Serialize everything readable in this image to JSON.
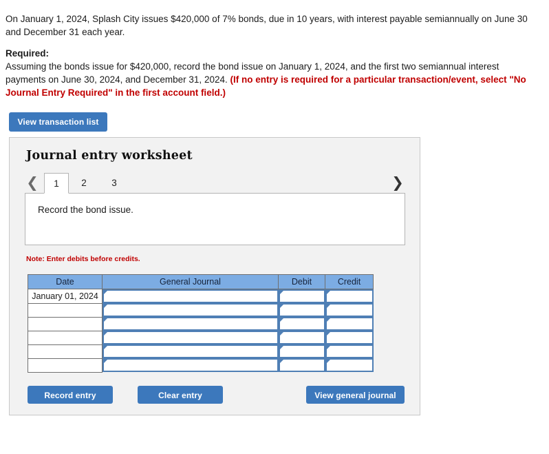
{
  "problem": {
    "statement": "On January 1, 2024, Splash City issues $420,000 of 7% bonds, due in 10 years, with interest payable semiannually on June 30 and December 31 each year."
  },
  "required": {
    "label": "Required:",
    "body_normal": "Assuming the bonds issue for $420,000, record the bond issue on January 1, 2024, and the first two semiannual interest payments on June 30, 2024, and December 31, 2024. ",
    "body_red": "(If no entry is required for a particular transaction/event, select \"No Journal Entry Required\" in the first account field.)"
  },
  "toolbar": {
    "view_transaction_list_label": "View transaction list"
  },
  "worksheet": {
    "title": "Journal entry worksheet",
    "prev_icon": "chevron-left-icon",
    "next_icon": "chevron-right-icon",
    "tabs": [
      {
        "label": "1",
        "active": true
      },
      {
        "label": "2",
        "active": false
      },
      {
        "label": "3",
        "active": false
      }
    ],
    "instruction": "Record the bond issue.",
    "note": "Note: Enter debits before credits.",
    "table": {
      "headers": [
        "Date",
        "General Journal",
        "Debit",
        "Credit"
      ],
      "rows": [
        {
          "date": "January 01, 2024",
          "general_journal": "",
          "debit": "",
          "credit": ""
        },
        {
          "date": "",
          "general_journal": "",
          "debit": "",
          "credit": ""
        },
        {
          "date": "",
          "general_journal": "",
          "debit": "",
          "credit": ""
        },
        {
          "date": "",
          "general_journal": "",
          "debit": "",
          "credit": ""
        },
        {
          "date": "",
          "general_journal": "",
          "debit": "",
          "credit": ""
        },
        {
          "date": "",
          "general_journal": "",
          "debit": "",
          "credit": ""
        }
      ]
    },
    "buttons": {
      "record_entry": "Record entry",
      "clear_entry": "Clear entry",
      "view_general_journal": "View general journal"
    }
  },
  "colors": {
    "button_blue": "#3C78BC",
    "table_header_blue": "#7CACE3",
    "note_red": "#C00000",
    "panel_gray": "#F2F2F2",
    "cell_border_blue": "#4F7FB5"
  }
}
